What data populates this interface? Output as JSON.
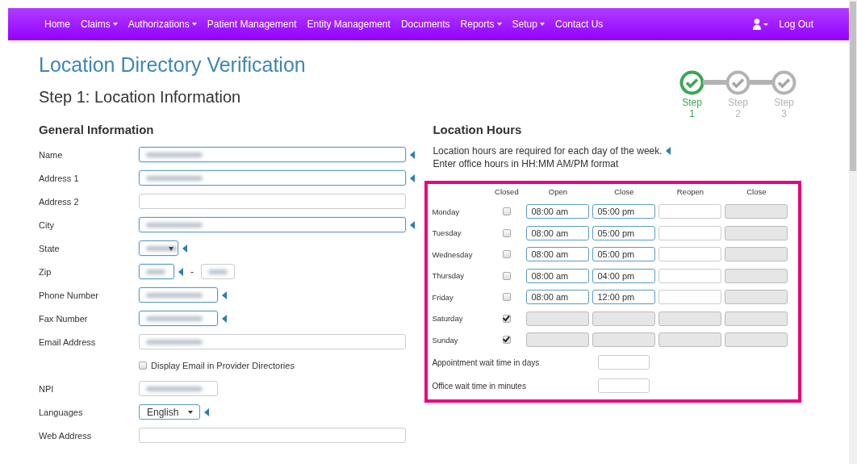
{
  "nav": {
    "items": [
      {
        "label": "Home",
        "dropdown": false
      },
      {
        "label": "Claims",
        "dropdown": true
      },
      {
        "label": "Authorizations",
        "dropdown": true
      },
      {
        "label": "Patient Management",
        "dropdown": false
      },
      {
        "label": "Entity Management",
        "dropdown": false
      },
      {
        "label": "Documents",
        "dropdown": false
      },
      {
        "label": "Reports",
        "dropdown": true
      },
      {
        "label": "Setup",
        "dropdown": true
      },
      {
        "label": "Contact Us",
        "dropdown": false
      }
    ],
    "logout": "Log Out"
  },
  "title": "Location Directory Verification",
  "step_title": "Step 1: Location Information",
  "steps": [
    {
      "label": "Step",
      "number": "1",
      "done": true
    },
    {
      "label": "Step",
      "number": "2",
      "done": false
    },
    {
      "label": "Step",
      "number": "3",
      "done": false
    }
  ],
  "general": {
    "heading": "General Information",
    "fields": [
      {
        "label": "Name",
        "kind": "text",
        "required": true,
        "redacted": true
      },
      {
        "label": "Address 1",
        "kind": "text",
        "required": true,
        "redacted": true
      },
      {
        "label": "Address 2",
        "kind": "text",
        "required": false,
        "redacted": false
      },
      {
        "label": "City",
        "kind": "text",
        "required": true,
        "redacted": true
      },
      {
        "label": "State",
        "kind": "select",
        "required": true,
        "redacted": true
      },
      {
        "label": "Zip",
        "kind": "zip",
        "required": true,
        "redacted": true,
        "separator": "-"
      },
      {
        "label": "Phone Number",
        "kind": "short",
        "required": true,
        "redacted": true
      },
      {
        "label": "Fax Number",
        "kind": "short",
        "required": true,
        "redacted": true
      },
      {
        "label": "Email Address",
        "kind": "text",
        "required": false,
        "redacted": true
      },
      {
        "kind": "checkbox",
        "text": "Display Email in Provider Directories",
        "checked": false
      },
      {
        "label": "NPI",
        "kind": "short",
        "required": false,
        "redacted": true
      },
      {
        "label": "Languages",
        "kind": "dropdown",
        "value": "English",
        "required": true
      },
      {
        "label": "Web Address",
        "kind": "text",
        "required": false,
        "redacted": false
      }
    ]
  },
  "hours": {
    "heading": "Location Hours",
    "notes": [
      "Location hours are required for each day of the week.",
      "Enter office hours in HH:MM AM/PM format"
    ],
    "columns": [
      "Closed",
      "Open",
      "Close",
      "Reopen",
      "Close"
    ],
    "days": [
      {
        "day": "Monday",
        "closed": false,
        "times": [
          {
            "value": "08:00 am",
            "disabled": false
          },
          {
            "value": "05:00 pm",
            "disabled": false
          },
          {
            "disabled": false
          },
          {
            "disabled": true
          }
        ]
      },
      {
        "day": "Tuesday",
        "closed": false,
        "times": [
          {
            "value": "08:00 am",
            "disabled": false
          },
          {
            "value": "05:00 pm",
            "disabled": false
          },
          {
            "disabled": false
          },
          {
            "disabled": true
          }
        ]
      },
      {
        "day": "Wednesday",
        "closed": false,
        "times": [
          {
            "value": "08:00 am",
            "disabled": false
          },
          {
            "value": "05:00 pm",
            "disabled": false
          },
          {
            "disabled": false
          },
          {
            "disabled": true
          }
        ]
      },
      {
        "day": "Thursday",
        "closed": false,
        "times": [
          {
            "value": "08:00 am",
            "disabled": false
          },
          {
            "value": "04:00 pm",
            "disabled": false
          },
          {
            "disabled": false
          },
          {
            "disabled": true
          }
        ]
      },
      {
        "day": "Friday",
        "closed": false,
        "times": [
          {
            "value": "08:00 am",
            "disabled": false
          },
          {
            "value": "12:00 pm",
            "disabled": false
          },
          {
            "disabled": false
          },
          {
            "disabled": true
          }
        ]
      },
      {
        "day": "Saturday",
        "closed": true,
        "times": [
          {
            "disabled": true
          },
          {
            "disabled": true
          },
          {
            "disabled": true
          },
          {
            "disabled": true
          }
        ]
      },
      {
        "day": "Sunday",
        "closed": true,
        "times": [
          {
            "disabled": true
          },
          {
            "disabled": true
          },
          {
            "disabled": true
          },
          {
            "disabled": true
          }
        ]
      }
    ],
    "waits": [
      {
        "label": "Appointment wait time in days"
      },
      {
        "label": "Office wait time in minutes"
      }
    ]
  }
}
